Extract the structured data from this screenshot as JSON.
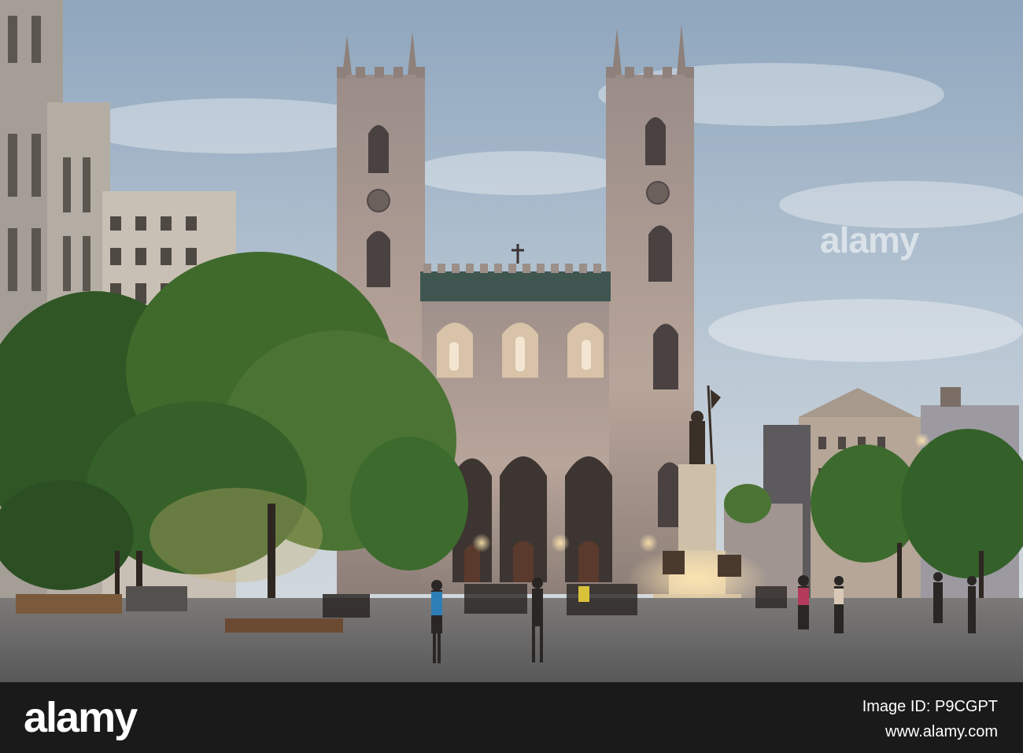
{
  "watermark": {
    "center_text": "alamy",
    "footer_logo": "alamy",
    "image_id": "Image ID: P9CGPT",
    "site_url": "www.alamy.com"
  },
  "colors": {
    "sky": "#b7c6d6",
    "stone": "#a89a92",
    "tree": "#3f6a2c",
    "pavement": "#6e6e70",
    "footer": "#1a1a1a"
  }
}
